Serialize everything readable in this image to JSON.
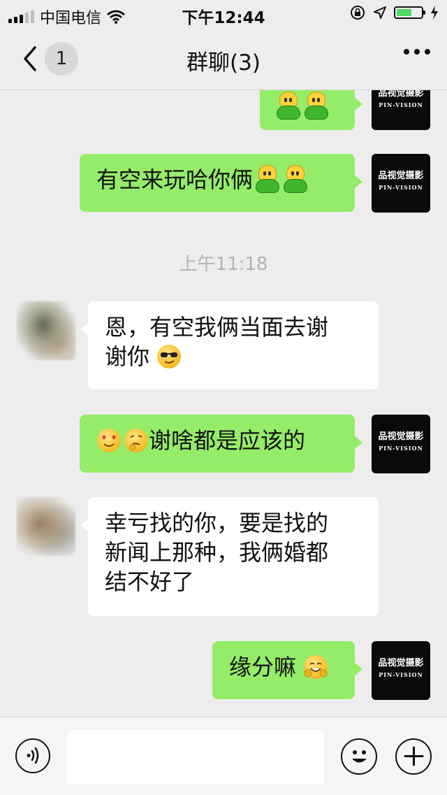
{
  "status_bar": {
    "carrier": "中国电信",
    "time": "下午12:44"
  },
  "header": {
    "back_badge": "1",
    "title": "群聊(3)"
  },
  "avatar_brand": {
    "zh": "品视觉摄影",
    "en": "PIN-VISION"
  },
  "messages": [
    {
      "sender": "me",
      "text": ""
    },
    {
      "sender": "me",
      "text": "有空来玩哈你俩"
    },
    {
      "sender": "system",
      "text": "上午11:18"
    },
    {
      "sender": "other",
      "line1": "恩，有空我俩当面去谢",
      "line2": "谢你"
    },
    {
      "sender": "me",
      "text": "谢啥都是应该的"
    },
    {
      "sender": "other",
      "line1": "幸亏找的你，要是找的",
      "line2": "新闻上那种，我俩婚都",
      "line3": "结不好了"
    },
    {
      "sender": "me",
      "text": "缘分嘛"
    }
  ],
  "input_bar": {
    "placeholder": ""
  },
  "colors": {
    "my_bubble": "#95ec69",
    "their_bubble": "#ffffff",
    "background": "#ededed"
  }
}
